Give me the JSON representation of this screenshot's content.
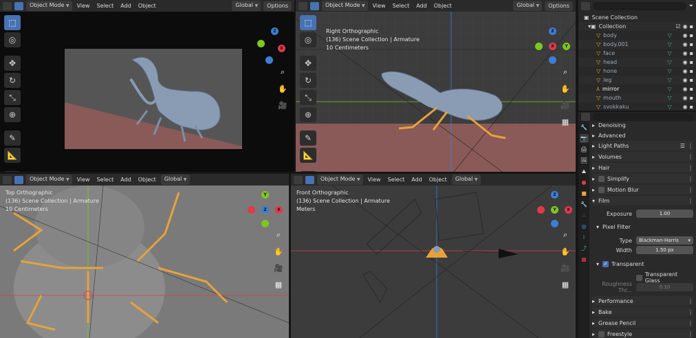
{
  "viewport_tl": {
    "mode": "Object Mode",
    "menus": [
      "View",
      "Select",
      "Add",
      "Object"
    ],
    "transform": "Global",
    "options": "Options"
  },
  "viewport_tr": {
    "mode": "Object Mode",
    "menus": [
      "View",
      "Select",
      "Add",
      "Object"
    ],
    "transform": "Global",
    "options": "Options",
    "info": [
      "Right Orthographic",
      "(136) Scene Collection | Armature",
      "10 Centimeters"
    ]
  },
  "viewport_bl": {
    "mode": "Object Mode",
    "menus": [
      "View",
      "Select",
      "Add",
      "Object"
    ],
    "transform": "Global",
    "info": [
      "Top Orthographic",
      "(136) Scene Collection | Armature",
      "10 Centimeters"
    ]
  },
  "viewport_br": {
    "mode": "Object Mode",
    "menus": [
      "View",
      "Select",
      "Add",
      "Object"
    ],
    "transform": "Global",
    "info": [
      "Front Orthographic",
      "(136) Scene Collection | Armature",
      "Meters"
    ]
  },
  "outliner": {
    "root": "Scene Collection",
    "collection": "Collection",
    "items": [
      "body",
      "body.001",
      "face",
      "head",
      "hone",
      "leg",
      "mirror",
      "mouth",
      "svokkaku"
    ]
  },
  "properties": {
    "sections": {
      "denoising": "Denoising",
      "advanced": "Advanced",
      "light_paths": "Light Paths",
      "volumes": "Volumes",
      "hair": "Hair",
      "simplify": "Simplify",
      "motion_blur": "Motion Blur",
      "film": "Film",
      "pixel_filter": "Pixel Filter",
      "transparent": "Transparent",
      "performance": "Performance",
      "bake": "Bake",
      "grease_pencil": "Grease Pencil",
      "freestyle": "Freestyle"
    },
    "exposure_label": "Exposure",
    "exposure_value": "1.00",
    "type_label": "Type",
    "type_value": "Blackman-Harris",
    "width_label": "Width",
    "width_value": "1.50 px",
    "transparent_glass": "Transparent Glass",
    "roughness_label": "Roughness Thr...",
    "roughness_value": "0.10"
  },
  "colors": {
    "accent": "#4772b3",
    "axis_x": "#e03a4b",
    "axis_y": "#7ec71e",
    "axis_z": "#3b7fd6",
    "bone": "#e8a23a",
    "ground": "#8a5a58"
  }
}
